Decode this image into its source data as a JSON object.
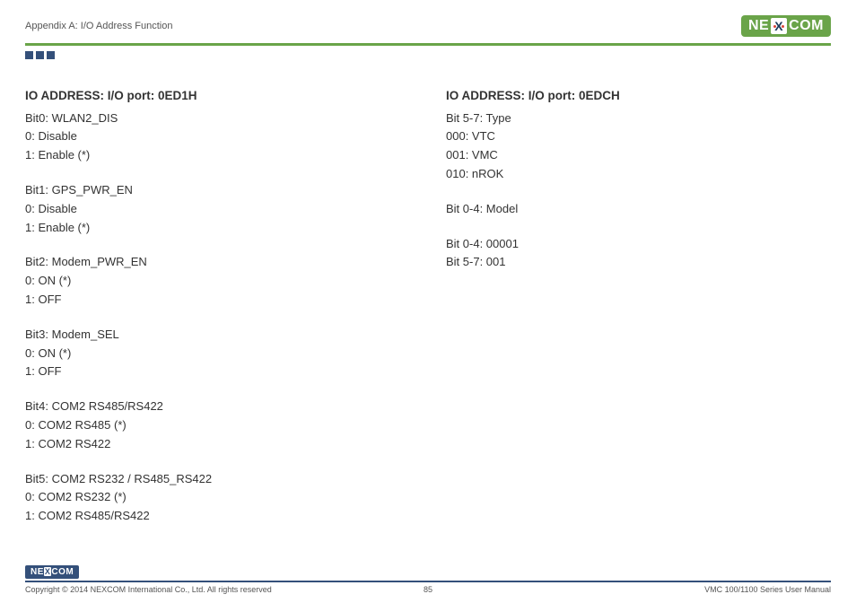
{
  "header": {
    "title": "Appendix A: I/O Address Function",
    "logo_ne": "NE",
    "logo_x": "X",
    "logo_com": "COM"
  },
  "left": {
    "title": "IO ADDRESS: I/O port: 0ED1H",
    "b0": {
      "l1": "Bit0: WLAN2_DIS",
      "l2": "0: Disable",
      "l3": "1: Enable (*)"
    },
    "b1": {
      "l1": "Bit1: GPS_PWR_EN",
      "l2": "0: Disable",
      "l3": "1: Enable (*)"
    },
    "b2": {
      "l1": "Bit2: Modem_PWR_EN",
      "l2": "0: ON (*)",
      "l3": "1: OFF"
    },
    "b3": {
      "l1": "Bit3: Modem_SEL",
      "l2": "0: ON (*)",
      "l3": "1: OFF"
    },
    "b4": {
      "l1": "Bit4: COM2 RS485/RS422",
      "l2": "0: COM2 RS485 (*)",
      "l3": "1: COM2 RS422"
    },
    "b5": {
      "l1": "Bit5: COM2 RS232 / RS485_RS422",
      "l2": "0: COM2 RS232 (*)",
      "l3": "1: COM2 RS485/RS422"
    }
  },
  "right": {
    "title": "IO ADDRESS: I/O port: 0EDCH",
    "g1": {
      "l1": "Bit 5-7: Type",
      "l2": "000: VTC",
      "l3": "001: VMC",
      "l4": "010: nROK"
    },
    "g2": {
      "l1": "Bit 0-4: Model"
    },
    "g3": {
      "l1": "Bit 0-4: 00001",
      "l2": "Bit 5-7: 001"
    }
  },
  "footer": {
    "logo_ne": "NE",
    "logo_x": "X",
    "logo_com": "COM",
    "copyright": "Copyright © 2014 NEXCOM International Co., Ltd. All rights reserved",
    "page": "85",
    "doc": "VMC 100/1100 Series User Manual"
  }
}
